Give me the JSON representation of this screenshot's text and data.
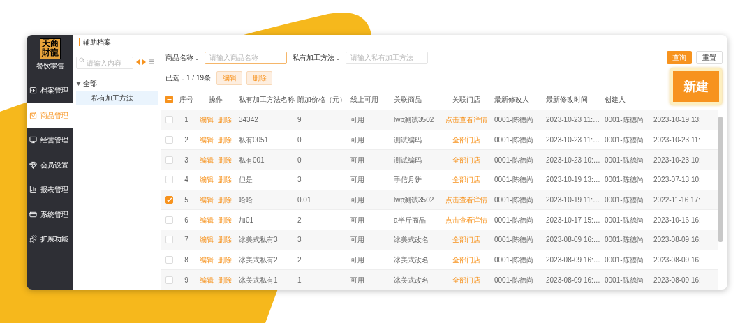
{
  "sidebar": {
    "logo": "天商財龍",
    "subtitle": "餐饮零售",
    "items": [
      {
        "label": "档案管理",
        "selected": false
      },
      {
        "label": "商品管理",
        "selected": true
      },
      {
        "label": "经营管理",
        "selected": false
      },
      {
        "label": "会员设置",
        "selected": false
      },
      {
        "label": "报表管理",
        "selected": false
      },
      {
        "label": "系统管理",
        "selected": false
      },
      {
        "label": "扩展功能",
        "selected": false
      }
    ]
  },
  "panel_title": "辅助档案",
  "tree": {
    "search": {
      "placeholder": "请输入内容"
    },
    "nodes": [
      {
        "label": "全部",
        "expanded": true,
        "selected": false,
        "children": [
          {
            "label": "私有加工方法",
            "selected": true
          }
        ]
      }
    ]
  },
  "filters": [
    {
      "label": "商品名称：",
      "placeholder": "请输入商品名称",
      "focused": true
    },
    {
      "label": "私有加工方法：",
      "placeholder": "请输入私有加工方法",
      "focused": false
    }
  ],
  "actions": [
    {
      "label": "查询",
      "kind": "primary"
    },
    {
      "label": "重置",
      "kind": "default"
    }
  ],
  "new_button": "新建",
  "selection": {
    "summary": "已选：1 / 19条",
    "buttons": [
      "编辑",
      "删除"
    ]
  },
  "table": {
    "select_all": {
      "indeterminate": true
    },
    "columns": [
      "序号",
      "操作",
      "私有加工方法名称",
      "附加价格（元）",
      "线上可用",
      "关联商品",
      "关联门店",
      "最新修改人",
      "最新修改时间",
      "创建人"
    ],
    "rows": [
      {
        "checked": false,
        "index": "1",
        "actions": [
          "编辑",
          "删除"
        ],
        "name": "34342",
        "price": "9",
        "online": "可用",
        "product": "lwp测试3502",
        "store": "点击查看详情",
        "modifier": "0001-陈德尚",
        "modified": "2023-10-23 11:…",
        "creator": "0001-陈德尚",
        "column_10": "2023-10-19 13:"
      },
      {
        "checked": false,
        "index": "2",
        "actions": [
          "编辑",
          "删除"
        ],
        "name": "私有0051",
        "price": "0",
        "online": "可用",
        "product": "测试编码",
        "store": "全部门店",
        "modifier": "0001-陈德尚",
        "modified": "2023-10-23 11:…",
        "creator": "0001-陈德尚",
        "column_10": "2023-10-23 11:"
      },
      {
        "checked": false,
        "index": "3",
        "actions": [
          "编辑",
          "删除"
        ],
        "name": "私有001",
        "price": "0",
        "online": "可用",
        "product": "测试编码",
        "store": "全部门店",
        "modifier": "0001-陈德尚",
        "modified": "2023-10-23 10:…",
        "creator": "0001-陈德尚",
        "column_10": "2023-10-23 10:"
      },
      {
        "checked": false,
        "index": "4",
        "actions": [
          "编辑",
          "删除"
        ],
        "name": "但是",
        "price": "3",
        "online": "可用",
        "product": "手信月饼",
        "store": "全部门店",
        "modifier": "0001-陈德尚",
        "modified": "2023-10-19 13:…",
        "creator": "0001-陈德尚",
        "column_10": "2023-07-13 10:"
      },
      {
        "checked": true,
        "index": "5",
        "actions": [
          "编辑",
          "删除"
        ],
        "name": "哈哈",
        "price": "0.01",
        "online": "可用",
        "product": "lwp测试3502",
        "store": "点击查看详情",
        "modifier": "0001-陈德尚",
        "modified": "2023-10-19 11:…",
        "creator": "0001-陈德尚",
        "column_10": "2022-11-16 17:"
      },
      {
        "checked": false,
        "index": "6",
        "actions": [
          "编辑",
          "删除"
        ],
        "name": "加01",
        "price": "2",
        "online": "可用",
        "product": "a半斤商品",
        "store": "点击查看详情",
        "modifier": "0001-陈德尚",
        "modified": "2023-10-17 15:…",
        "creator": "0001-陈德尚",
        "column_10": "2023-10-16 16:"
      },
      {
        "checked": false,
        "index": "7",
        "actions": [
          "编辑",
          "删除"
        ],
        "name": "冰美式私有3",
        "price": "3",
        "online": "可用",
        "product": "冰美式改名",
        "store": "全部门店",
        "modifier": "0001-陈德尚",
        "modified": "2023-08-09 16:…",
        "creator": "0001-陈德尚",
        "column_10": "2023-08-09 16:"
      },
      {
        "checked": false,
        "index": "8",
        "actions": [
          "编辑",
          "删除"
        ],
        "name": "冰美式私有2",
        "price": "2",
        "online": "可用",
        "product": "冰美式改名",
        "store": "全部门店",
        "modifier": "0001-陈德尚",
        "modified": "2023-08-09 16:…",
        "creator": "0001-陈德尚",
        "column_10": "2023-08-09 16:"
      },
      {
        "checked": false,
        "index": "9",
        "actions": [
          "编辑",
          "删除"
        ],
        "name": "冰美式私有1",
        "price": "1",
        "online": "可用",
        "product": "冰美式改名",
        "store": "全部门店",
        "modifier": "0001-陈德尚",
        "modified": "2023-08-09 16:…",
        "creator": "0001-陈德尚",
        "column_10": "2023-08-09 16:"
      }
    ]
  }
}
